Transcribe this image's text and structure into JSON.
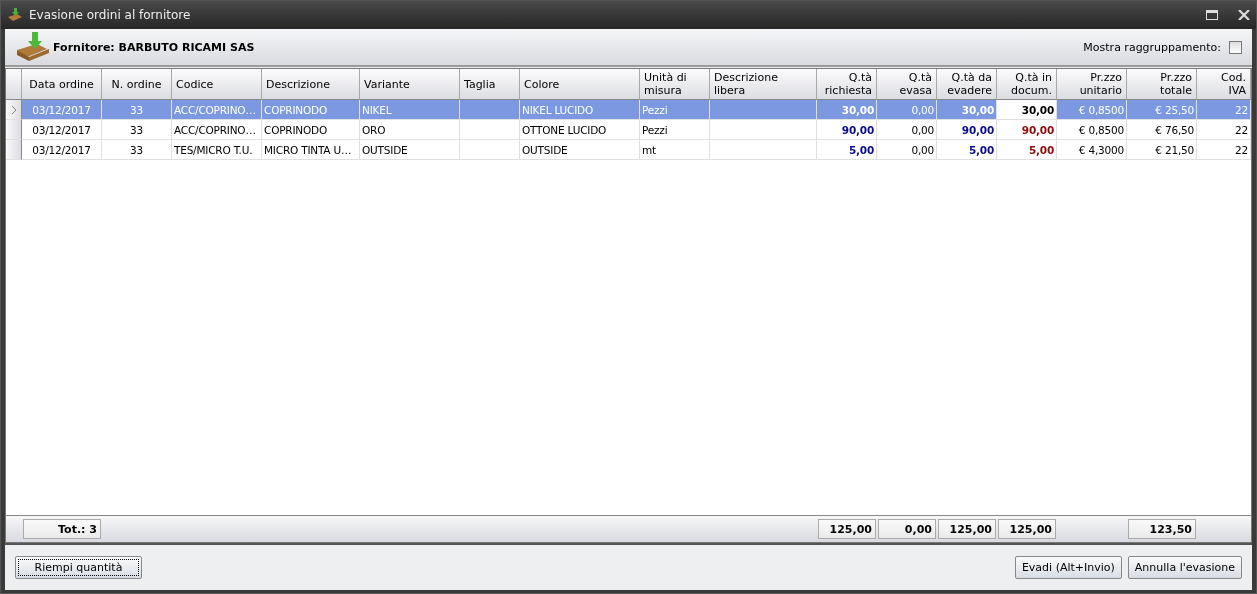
{
  "window": {
    "title": "Evasione ordini al fornitore"
  },
  "supplier": {
    "label": "Fornitore: BARBUTO RICAMI SAS"
  },
  "grouping": {
    "label": "Mostra raggruppamento:",
    "checked": false
  },
  "table": {
    "columns": [
      {
        "label": "Data ordine",
        "kind": "center",
        "total": "Tot.: 3",
        "focused": false
      },
      {
        "label": "N. ordine",
        "kind": "center",
        "focused": false
      },
      {
        "label": "Codice",
        "kind": "text",
        "focused": false
      },
      {
        "label": "Descrizione",
        "kind": "text",
        "focused": false
      },
      {
        "label": "Variante",
        "kind": "text",
        "focused": false
      },
      {
        "label": "Taglia",
        "kind": "text",
        "focused": false
      },
      {
        "label": "Colore",
        "kind": "text",
        "focused": false
      },
      {
        "label": "Unità di misura",
        "kind": "text",
        "focused": false
      },
      {
        "label": "Descrizione libera",
        "kind": "text",
        "focused": false
      },
      {
        "label": "Q.tà richiesta",
        "kind": "qty",
        "total": "125,00",
        "focused": false
      },
      {
        "label": "Q.tà evasa",
        "kind": "number",
        "total": "0,00",
        "focused": false
      },
      {
        "label": "Q.tà da evadere",
        "kind": "qty",
        "total": "125,00",
        "focused": false
      },
      {
        "label": "Q.tà in docum.",
        "kind": "doc",
        "total": "125,00",
        "focused": true
      },
      {
        "label": "Pr.zzo unitario",
        "kind": "number",
        "focused": false
      },
      {
        "label": "Pr.zzo totale",
        "kind": "number",
        "total": "123,50",
        "focused": false
      },
      {
        "label": "Cod. IVA",
        "kind": "number",
        "focused": false
      }
    ],
    "rows": [
      {
        "selected": true,
        "cells": [
          "03/12/2017",
          "33",
          "ACC/COPRINO…",
          "COPRINODO",
          "NIKEL",
          null,
          "NIKEL LUCIDO",
          "Pezzi",
          null,
          "30,00",
          "0,00",
          "30,00",
          "30,00",
          "€ 0,8500",
          "€ 25,50",
          "22"
        ]
      },
      {
        "selected": false,
        "cells": [
          "03/12/2017",
          "33",
          "ACC/COPRINO…",
          "COPRINODO",
          "ORO",
          null,
          "OTTONE LUCIDO",
          "Pezzi",
          null,
          "90,00",
          "0,00",
          "90,00",
          "90,00",
          "€ 0,8500",
          "€ 76,50",
          "22"
        ]
      },
      {
        "selected": false,
        "cells": [
          "03/12/2017",
          "33",
          "TES/MICRO T.U.",
          "MICRO TINTA U…",
          "OUTSIDE",
          null,
          "OUTSIDE",
          "mt",
          null,
          "5,00",
          "0,00",
          "5,00",
          "5,00",
          "€ 4,3000",
          "€ 21,50",
          "22"
        ]
      }
    ]
  },
  "buttons_left": [
    "Riempi quantità"
  ],
  "buttons_right": [
    "Evadi (Alt+Invio)",
    "Annulla l'evasione"
  ]
}
